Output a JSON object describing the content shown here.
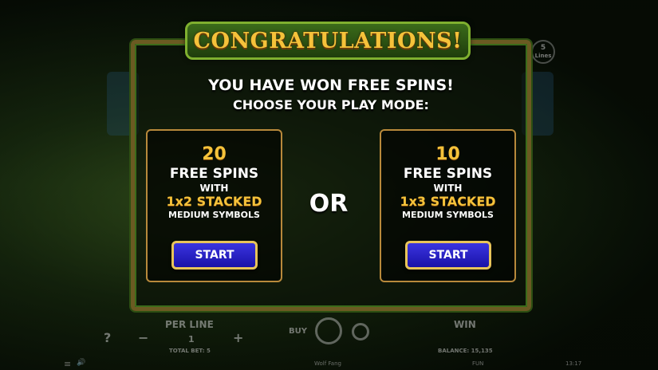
{
  "dialog": {
    "banner": "CONGRATULATIONS!",
    "headline": "YOU HAVE WON FREE SPINS!",
    "subheadline": "CHOOSE YOUR PLAY MODE:",
    "separator": "OR",
    "options": [
      {
        "count": "20",
        "free_spins": "FREE SPINS",
        "with": "WITH",
        "stacked": "1x2 STACKED",
        "symbols": "MEDIUM SYMBOLS",
        "button": "START"
      },
      {
        "count": "10",
        "free_spins": "FREE SPINS",
        "with": "WITH",
        "stacked": "1x3 STACKED",
        "symbols": "MEDIUM SYMBOLS",
        "button": "START"
      }
    ]
  },
  "background": {
    "lines_badge_count": "5",
    "lines_badge_label": "Lines"
  },
  "bottom_bar": {
    "help": "?",
    "per_line_label": "PER LINE",
    "minus": "−",
    "per_line_value": "1",
    "plus": "+",
    "total_bet": "TOTAL BET: 5",
    "buy_label": "BUY",
    "win_label": "WIN",
    "balance": "BALANCE: 15,135",
    "menu_icon": "≡",
    "sound_icon": "🔊",
    "game_name": "Wolf Fang",
    "mode": "FUN",
    "time": "13:17"
  },
  "colors": {
    "gold": "#f5c23a",
    "start_button": "#2a22c8",
    "frame": "#6b5a22",
    "banner_green": "#3b6b1a"
  }
}
